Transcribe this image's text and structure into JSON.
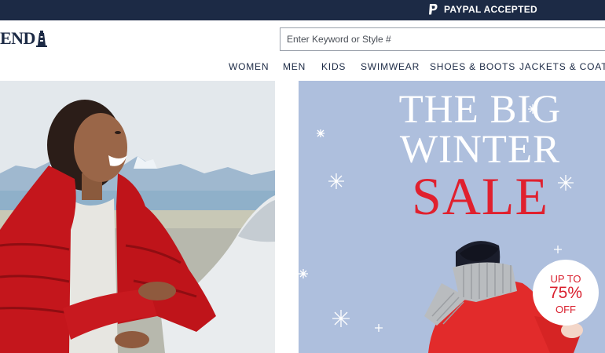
{
  "topbar": {
    "paypal_text": "PAYPAL ACCEPTED",
    "paypal_icon": "paypal-icon"
  },
  "header": {
    "logo_text": "END",
    "logo_icon": "lighthouse-icon"
  },
  "search": {
    "placeholder": "Enter Keyword or Style #",
    "value": ""
  },
  "nav": {
    "items": [
      "WOMEN",
      "MEN",
      "KIDS",
      "SWIMWEAR",
      "SHOES & BOOTS",
      "JACKETS & COATS"
    ]
  },
  "promo": {
    "line1": "THE BIG",
    "line2": "WINTER",
    "line3": "SALE",
    "badge_line1": "UP TO",
    "badge_line2": "75%",
    "badge_line3": "OFF"
  },
  "colors": {
    "topbar_bg": "#1c2a45",
    "brand_navy": "#1c2a45",
    "sale_red": "#e0202e",
    "promo_bg": "#aebfdd"
  }
}
